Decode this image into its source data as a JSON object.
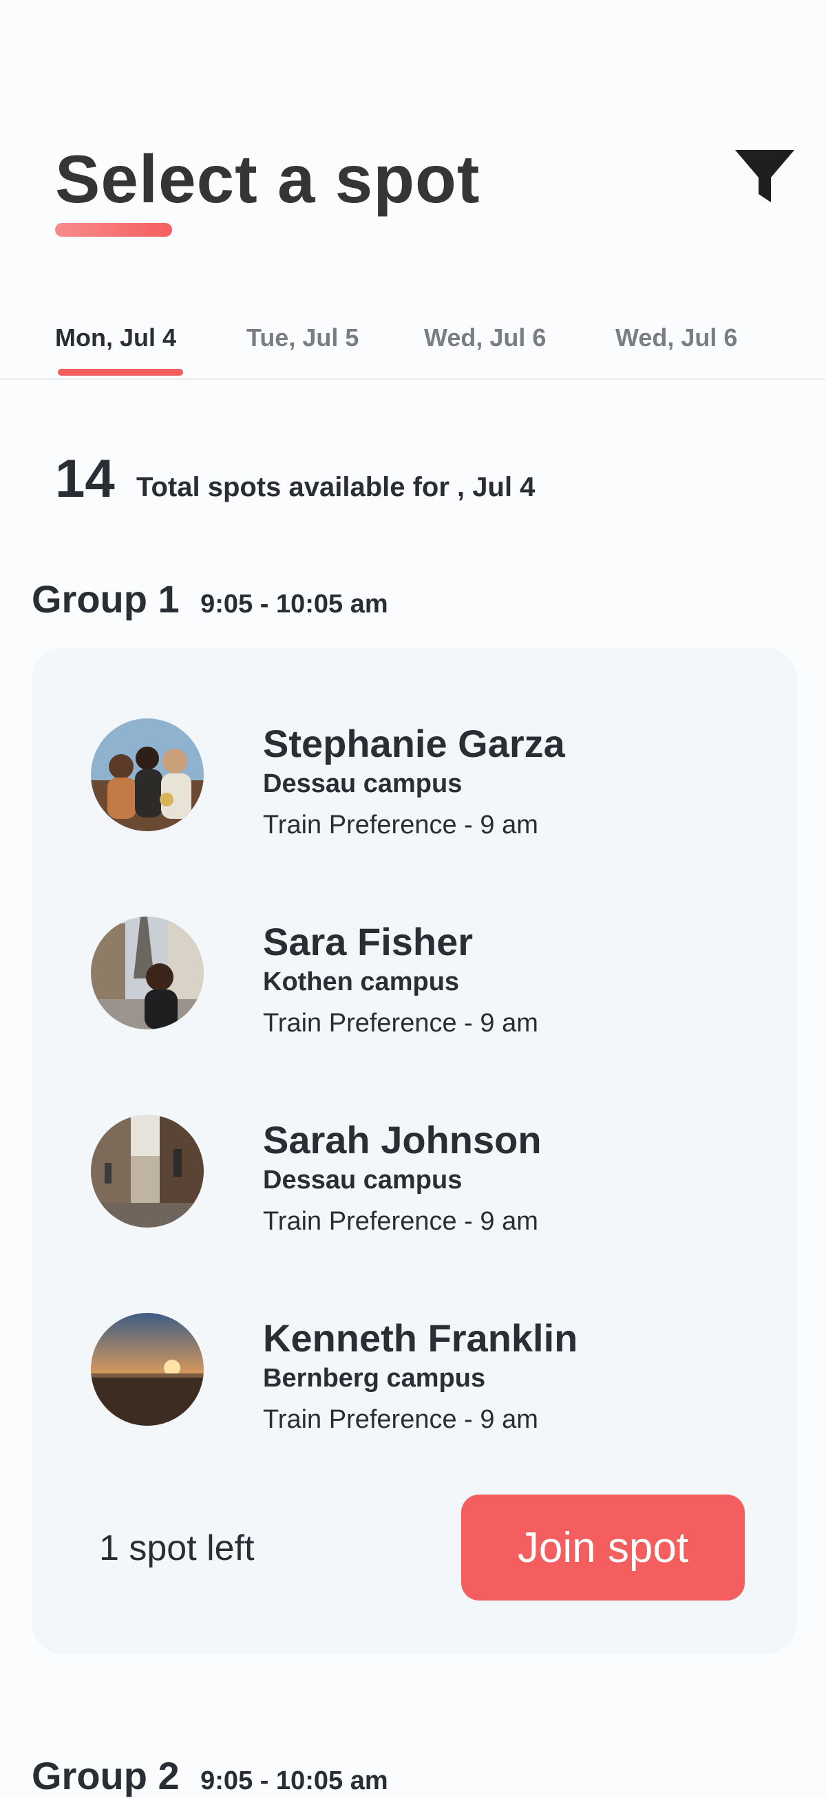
{
  "header": {
    "title": "Select a spot",
    "filter_icon": "filter-icon"
  },
  "tabs": [
    {
      "label": "Mon, Jul 4",
      "active": true
    },
    {
      "label": "Tue, Jul 5",
      "active": false
    },
    {
      "label": "Wed, Jul 6",
      "active": false
    },
    {
      "label": "Wed, Jul 6",
      "active": false
    }
  ],
  "summary": {
    "count": "14",
    "label": "Total spots available for , Jul 4"
  },
  "groups": [
    {
      "name": "Group 1",
      "time": "9:05 - 10:05 am",
      "members": [
        {
          "name": "Stephanie Garza",
          "campus": "Dessau campus",
          "preference": "Train Preference - 9 am"
        },
        {
          "name": "Sara Fisher",
          "campus": "Kothen campus",
          "preference": "Train Preference - 9 am"
        },
        {
          "name": "Sarah Johnson",
          "campus": "Dessau campus",
          "preference": "Train Preference - 9 am"
        },
        {
          "name": "Kenneth Franklin",
          "campus": "Bernberg campus",
          "preference": "Train Preference - 9 am"
        }
      ],
      "spots_left": "1 spot left",
      "join_label": "Join spot"
    },
    {
      "name": "Group 2",
      "time": "9:05 - 10:05 am"
    }
  ],
  "colors": {
    "accent": "#f45e5e",
    "card_bg": "#f3f7f9",
    "text": "#2a2d33",
    "muted_text": "#7a7d82"
  }
}
